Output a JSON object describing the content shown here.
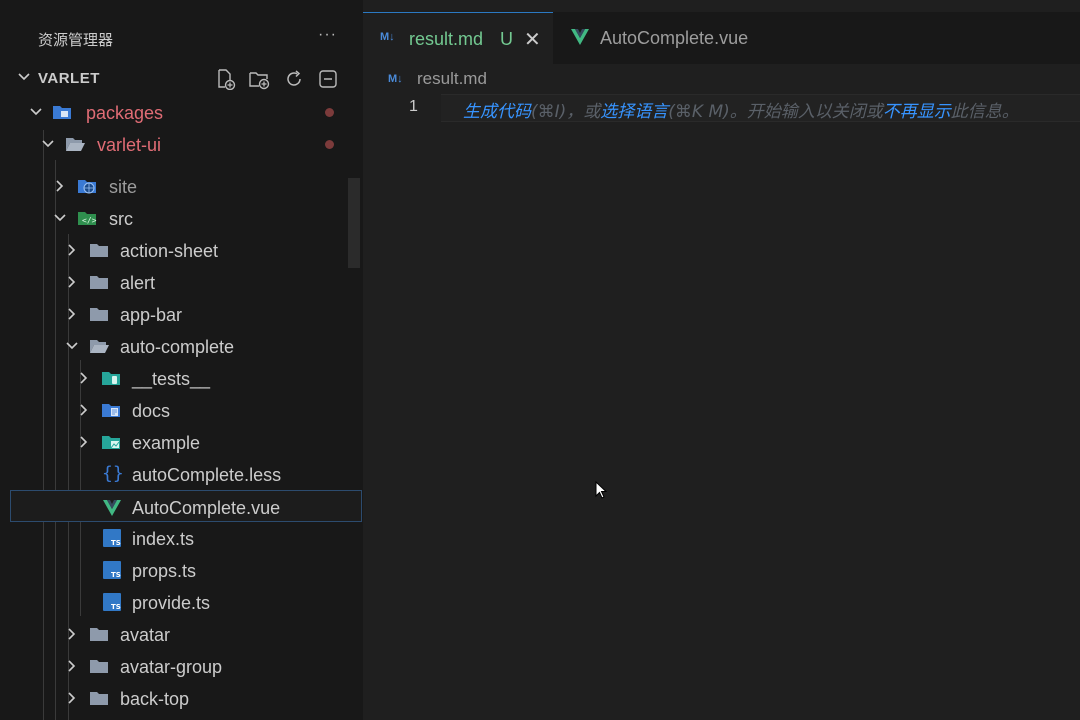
{
  "colors": {
    "accent": "#3794ff",
    "modified_red": "#e06c75",
    "folder_grey": "#8e9aab",
    "vue_green": "#41b883",
    "ts_blue": "#3178c6"
  },
  "sidebar": {
    "title": "资源管理器",
    "more": "···",
    "project": "VARLET",
    "actions": [
      "new-file-icon",
      "new-folder-icon",
      "refresh-icon",
      "collapse-all-icon"
    ],
    "tree": [
      {
        "label": "packages",
        "color": "#e06c75"
      },
      {
        "label": "varlet-ui",
        "color": "#e06c75"
      },
      {
        "label": "site",
        "color": "#9d9d9d"
      },
      {
        "label": "src",
        "color": "#cccccc"
      },
      {
        "label": "action-sheet",
        "color": "#cccccc"
      },
      {
        "label": "alert",
        "color": "#cccccc"
      },
      {
        "label": "app-bar",
        "color": "#cccccc"
      },
      {
        "label": "auto-complete",
        "color": "#cccccc"
      },
      {
        "label": "__tests__",
        "color": "#cccccc"
      },
      {
        "label": "docs",
        "color": "#cccccc"
      },
      {
        "label": "example",
        "color": "#cccccc"
      },
      {
        "label": "autoComplete.less",
        "color": "#cccccc"
      },
      {
        "label": "AutoComplete.vue",
        "color": "#cccccc"
      },
      {
        "label": "index.ts",
        "color": "#cccccc"
      },
      {
        "label": "props.ts",
        "color": "#cccccc"
      },
      {
        "label": "provide.ts",
        "color": "#cccccc"
      },
      {
        "label": "avatar",
        "color": "#cccccc"
      },
      {
        "label": "avatar-group",
        "color": "#cccccc"
      },
      {
        "label": "back-top",
        "color": "#cccccc"
      }
    ]
  },
  "editor": {
    "tabs": [
      {
        "label": "result.md",
        "status": "U",
        "close": "✕"
      },
      {
        "label": "AutoComplete.vue"
      }
    ],
    "breadcrumb": "result.md",
    "md_icon": "M↓",
    "line_number": "1",
    "hint": {
      "p1": "生成代码",
      "p2": "(⌘I)，或",
      "p3": "选择语言",
      "p4": "(⌘K M)。开始输入以关闭或",
      "p5": "不再显示",
      "p6": "此信息。"
    }
  }
}
